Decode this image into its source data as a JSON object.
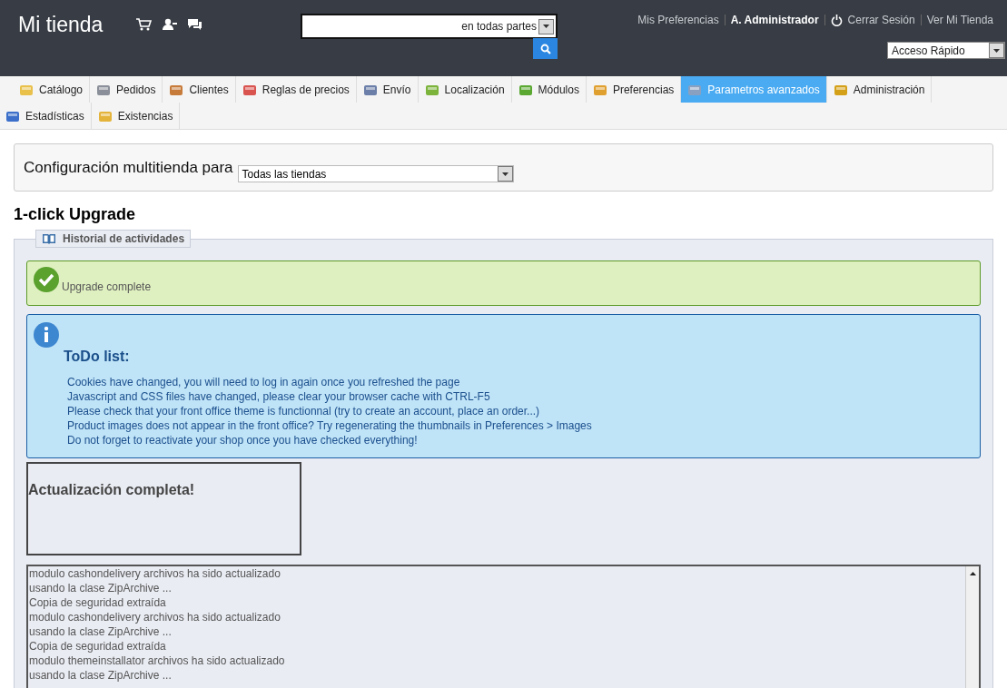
{
  "header": {
    "shop_name": "Mi tienda",
    "search": {
      "scope": "en todas partes"
    },
    "links": [
      {
        "label": "Mis Preferencias",
        "kind": "link"
      },
      {
        "label": "A. Administrador",
        "kind": "user"
      },
      {
        "label": "Cerrar Sesión",
        "kind": "logout"
      },
      {
        "label": "Ver Mi Tienda",
        "kind": "link"
      }
    ],
    "quick_access": "Acceso Rápido"
  },
  "tabs": [
    {
      "label": "Catálogo",
      "selected": false
    },
    {
      "label": "Pedidos",
      "selected": false
    },
    {
      "label": "Clientes",
      "selected": false
    },
    {
      "label": "Reglas de precios",
      "selected": false
    },
    {
      "label": "Envío",
      "selected": false
    },
    {
      "label": "Localización",
      "selected": false
    },
    {
      "label": "Módulos",
      "selected": false
    },
    {
      "label": "Preferencias",
      "selected": false
    },
    {
      "label": "Parametros avanzados",
      "selected": true
    },
    {
      "label": "Administración",
      "selected": false
    },
    {
      "label": "Estadísticas",
      "selected": false
    },
    {
      "label": "Existencias",
      "selected": false
    }
  ],
  "multistore": {
    "label": "Configuración multitienda para",
    "value": "Todas las tiendas"
  },
  "page_title": "1-click Upgrade",
  "panel": {
    "legend": "Historial de actividades",
    "success": "Upgrade complete",
    "todo": {
      "title": "ToDo list:",
      "items": [
        "Cookies have changed, you will need to log in again once you refreshed the page",
        "Javascript and CSS files have changed, please clear your browser cache with CTRL-F5",
        "Please check that your front office theme is functionnal (try to create an account, place an order...)",
        "Product images does not appear in the front office? Try regenerating the thumbnails in Preferences > Images",
        "Do not forget to reactivate your shop once you have checked everything!"
      ]
    },
    "status": "Actualización completa!",
    "log": [
      "modulo cashondelivery archivos ha sido actualizado",
      "usando la clase ZipArchive ...",
      "Copia de seguridad extraída",
      "modulo cashondelivery archivos ha sido actualizado",
      "usando la clase ZipArchive ...",
      "Copia de seguridad extraída",
      "modulo themeinstallator archivos ha sido actualizado",
      "usando la clase ZipArchive ..."
    ]
  }
}
